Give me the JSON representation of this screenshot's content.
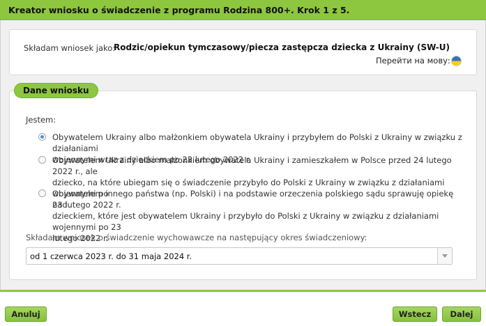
{
  "header": {
    "title": "Kreator wniosku o świadczenie z programu Rodzina 800+. Krok 1 z 5."
  },
  "info": {
    "label": "Składam wniosek jako:",
    "value": "Rodzic/opiekun tymczasowy/piecza zastępcza dziecka z Ukrainy (SW-U)",
    "language_link": "Перейти на мову:",
    "flag_icon": "ukraine-flag-icon",
    "flag_colors": [
      "#2f6fd0",
      "#f5d200"
    ]
  },
  "section": {
    "legend": "Dane wniosku",
    "question": "Jestem:",
    "options": [
      {
        "line1": "Obywatelem Ukrainy albo małżonkiem obywatela Ukrainy i przybyłem do Polski z Ukrainy w związku z działaniami",
        "line2": "wojennymi wraz z dzieckiem po 23 lutego 2022 r.",
        "line3": "",
        "selected": true
      },
      {
        "line1": "Obywatelem Ukrainy albo małżonkiem obywatela Ukrainy i zamieszkałem w Polsce przed 24 lutego 2022 r., ale",
        "line2": "dziecko, na które ubiegam się o świadczenie przybyło do Polski z Ukrainy w związku z działaniami wojennymi po",
        "line3": "23 lutego 2022 r.",
        "selected": false
      },
      {
        "line1": "Obywatelem innego państwa (np. Polski) i na podstawie orzeczenia polskiego sądu sprawuję opiekę nad",
        "line2": "dzieckiem, które jest obywatelem Ukrainy i przybyło do Polski z Ukrainy w związku z działaniami wojennymi po 23",
        "line3": "lutego 2022 r.",
        "selected": false
      }
    ],
    "period_label": "Składam wniosek o świadczenie wychowawcze na następujący okres świadczeniowy:",
    "period_value": "od 1 czerwca 2023 r. do 31 maja 2024 r."
  },
  "footer": {
    "cancel": "Anuluj",
    "back": "Wstecz",
    "next": "Dalej"
  },
  "colors": {
    "accent": "#8dc63f",
    "radio_selected": "#4a90d9"
  }
}
